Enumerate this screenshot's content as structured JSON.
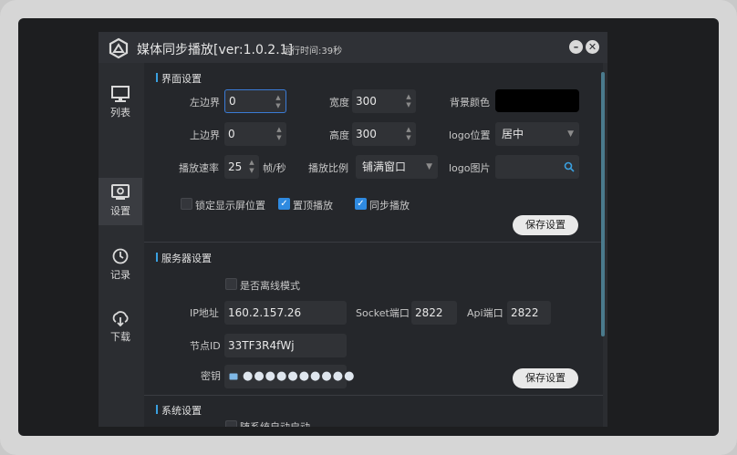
{
  "window": {
    "title": "媒体同步播放[ver:1.0.2.1]",
    "runtime": "运行时间:39秒",
    "minimize_glyph": "–",
    "close_glyph": "✕"
  },
  "sidebar": {
    "items": [
      {
        "label": "列表",
        "icon": "monitor-icon"
      },
      {
        "label": "设置",
        "icon": "settings-icon"
      },
      {
        "label": "记录",
        "icon": "history-icon"
      },
      {
        "label": "下载",
        "icon": "download-icon"
      }
    ],
    "active": "设置"
  },
  "ui_settings": {
    "section_title": "界面设置",
    "left_label": "左边界",
    "left_value": "0",
    "width_label": "宽度",
    "width_value": "300",
    "bg_label": "背景颜色",
    "bg_color": "#000000",
    "top_label": "上边界",
    "top_value": "0",
    "height_label": "高度",
    "height_value": "300",
    "logo_pos_label": "logo位置",
    "logo_pos_value": "居中",
    "rate_label": "播放速率",
    "rate_value": "25",
    "rate_unit": "帧/秒",
    "ratio_label": "播放比例",
    "ratio_value": "铺满窗口",
    "logo_img_label": "logo图片",
    "logo_img_value": "",
    "lock_label": "锁定显示屏位置",
    "lock_checked": false,
    "topmost_label": "置顶播放",
    "topmost_checked": true,
    "sync_label": "同步播放",
    "sync_checked": true,
    "save_label": "保存设置"
  },
  "server_settings": {
    "section_title": "服务器设置",
    "offline_label": "是否离线模式",
    "offline_checked": false,
    "ip_label": "IP地址",
    "ip_value": "160.2.157.26",
    "socket_label": "Socket端口",
    "socket_value": "2822",
    "api_label": "Api端口",
    "api_value": "2822",
    "node_label": "节点ID",
    "node_value": "33TF3R4fWj",
    "key_label": "密钥",
    "key_mask": "●●●●●●●●●●",
    "save_label": "保存设置"
  },
  "system_settings": {
    "section_title": "系统设置",
    "autostart_label": "随系统自动启动"
  }
}
